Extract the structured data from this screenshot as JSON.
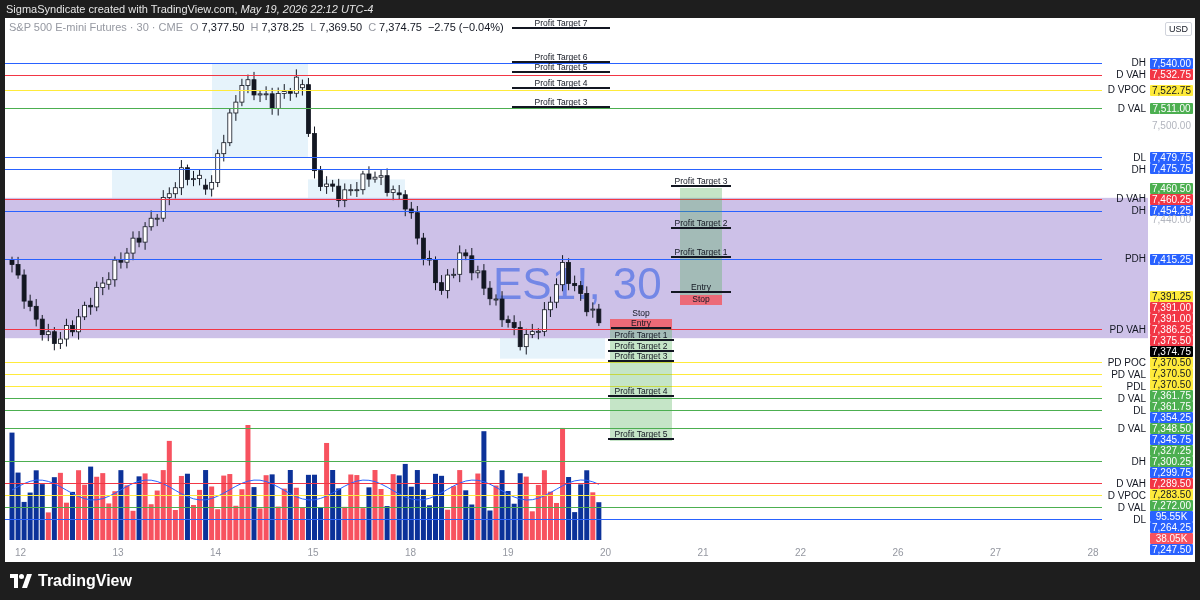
{
  "credit": "SigmaSyndicate created with TradingView.com, *May 19, 2026 22:12 UTC-4*",
  "legend": {
    "symbol": "S&P 500 E-mini Futures · 30 · CME",
    "values": [
      {
        "label": "O",
        "value": "7,377.50"
      },
      {
        "label": "H",
        "value": "7,378.25"
      },
      {
        "label": "L",
        "value": "7,369.50"
      },
      {
        "label": "C",
        "value": "7,374.75"
      }
    ],
    "change": "−2.75 (−0.04%)"
  },
  "currency_button": "USD",
  "watermark": "ES1!, 30",
  "trade_plans": [
    {
      "kind": "levels",
      "labels": [
        "Profit Target 7",
        "Profit Target 6",
        "Profit Target 5",
        "Profit Target 4",
        "Profit Target 3"
      ]
    },
    {
      "kind": "long",
      "labels": [
        "Profit Target 3",
        "Profit Target 2",
        "Profit Target 1",
        "Entry",
        "Stop"
      ]
    },
    {
      "kind": "short",
      "labels": [
        "Stop",
        "Entry",
        "Profit Target 1",
        "Profit Target 2",
        "Profit Target 3",
        "Profit Target 4",
        "Profit Target 5"
      ]
    }
  ],
  "price_axis": [
    {
      "kind": "price",
      "text": "7,540.00",
      "color": "#2962ff",
      "line_label": "DH"
    },
    {
      "kind": "price",
      "text": "7,532.75",
      "color": "#f23645",
      "line_label": "D VAH"
    },
    {
      "kind": "price",
      "text": "7,522.75",
      "color": "#ffeb3b",
      "line_label": "D VPOC"
    },
    {
      "kind": "price",
      "text": "7,511.00",
      "color": "#4caf50",
      "line_label": "D VAL"
    },
    {
      "kind": "tick",
      "text": "7,500.00"
    },
    {
      "kind": "price",
      "text": "7,479.75",
      "color": "#2962ff",
      "line_label": "DL"
    },
    {
      "kind": "price",
      "text": "7,475.75",
      "color": "#2962ff",
      "line_label": "DH"
    },
    {
      "kind": "price",
      "text": "7,460.50",
      "color": "#4caf50"
    },
    {
      "kind": "price",
      "text": "7,460.25",
      "color": "#f23645",
      "line_label": "D VAH"
    },
    {
      "kind": "price",
      "text": "7,454.25",
      "color": "#2962ff",
      "line_label": "DH"
    },
    {
      "kind": "tick",
      "text": "7,440.00"
    },
    {
      "kind": "price",
      "text": "7,415.25",
      "color": "#2962ff",
      "line_label": "PDH"
    },
    {
      "kind": "price",
      "text": "7,391.25",
      "color": "#ffeb3b"
    },
    {
      "kind": "price",
      "text": "7,391.00",
      "color": "#f23645"
    },
    {
      "kind": "price",
      "text": "7,391.00",
      "color": "#f23645"
    },
    {
      "kind": "price",
      "text": "7,386.25",
      "color": "#f23645",
      "line_label": "PD VAH"
    },
    {
      "kind": "price",
      "text": "7,375.50",
      "color": "#f23645"
    },
    {
      "kind": "price",
      "text": "7,374.75",
      "color": "#000000"
    },
    {
      "kind": "price",
      "text": "7,370.50",
      "color": "#ffeb3b",
      "line_label": "PD POC"
    },
    {
      "kind": "price",
      "text": "7,370.50",
      "color": "#ffeb3b",
      "line_label": "PD VAL"
    },
    {
      "kind": "price",
      "text": "7,370.50",
      "color": "#ffeb3b",
      "line_label": "PDL"
    },
    {
      "kind": "price",
      "text": "7,361.75",
      "color": "#4caf50",
      "line_label": "D VAL"
    },
    {
      "kind": "price",
      "text": "7,361.75",
      "color": "#4caf50",
      "line_label": "DL"
    },
    {
      "kind": "price",
      "text": "7,354.25",
      "color": "#2962ff"
    },
    {
      "kind": "price",
      "text": "7,348.50",
      "color": "#4caf50",
      "line_label": "D VAL"
    },
    {
      "kind": "price",
      "text": "7,345.75",
      "color": "#2962ff"
    },
    {
      "kind": "price",
      "text": "7,327.25",
      "color": "#4caf50"
    },
    {
      "kind": "price",
      "text": "7,300.25",
      "color": "#4caf50",
      "line_label": "DH"
    },
    {
      "kind": "price",
      "text": "7,299.75",
      "color": "#2962ff"
    },
    {
      "kind": "price",
      "text": "7,289.50",
      "color": "#f23645",
      "line_label": "D VAH"
    },
    {
      "kind": "price",
      "text": "7,283.50",
      "color": "#ffeb3b",
      "line_label": "D VPOC"
    },
    {
      "kind": "price",
      "text": "7,272.00",
      "color": "#4caf50",
      "line_label": "D VAL"
    },
    {
      "kind": "volume",
      "text": "95.55K",
      "color": "#2962ff",
      "line_label": "DL"
    },
    {
      "kind": "price",
      "text": "7,264.25",
      "color": "#2962ff"
    },
    {
      "kind": "volume",
      "text": "38.05K",
      "color": "#f7525f"
    },
    {
      "kind": "price",
      "text": "7,247.50",
      "color": "#2962ff"
    }
  ],
  "time_axis": [
    "12",
    "13",
    "14",
    "15",
    "18",
    "19",
    "20",
    "21",
    "22",
    "26",
    "27",
    "28"
  ],
  "footer": {
    "brand": "TradingView"
  }
}
